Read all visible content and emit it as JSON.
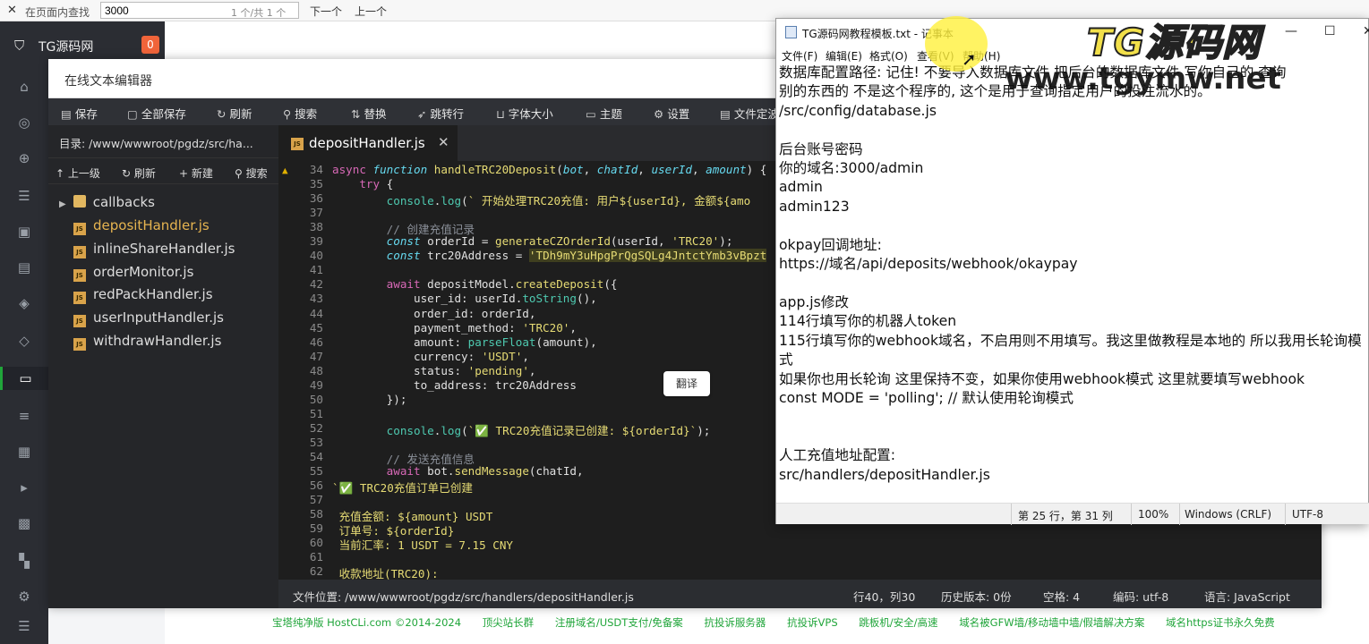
{
  "findbar": {
    "close": "✕",
    "label": "在页面内查找",
    "query": "3000",
    "count": "1 个/共 1 个",
    "next": "下一个",
    "prev": "上一个"
  },
  "brand": {
    "name": "TG源码网",
    "badge": "0"
  },
  "editor": {
    "title": "在线文本编辑器",
    "toolbar": [
      "保存",
      "全部保存",
      "刷新",
      "搜索",
      "替换",
      "跳转行",
      "字体大小",
      "主题",
      "设置",
      "文件定波"
    ],
    "dir": "目录: /www/wwwroot/pgdz/src/ha...",
    "tree_tools": [
      "上一级",
      "刷新",
      "新建",
      "搜索"
    ],
    "files": [
      {
        "name": "callbacks",
        "type": "folder"
      },
      {
        "name": "depositHandler.js",
        "type": "js",
        "selected": true
      },
      {
        "name": "inlineShareHandler.js",
        "type": "js"
      },
      {
        "name": "orderMonitor.js",
        "type": "js"
      },
      {
        "name": "redPackHandler.js",
        "type": "js"
      },
      {
        "name": "userInputHandler.js",
        "type": "js"
      },
      {
        "name": "withdrawHandler.js",
        "type": "js"
      }
    ],
    "tab": "depositHandler.js",
    "translate": "翻译",
    "status": {
      "path": "文件位置: /www/wwwroot/pgdz/src/handlers/depositHandler.js",
      "pos": "行40，列30",
      "history": "历史版本: 0份",
      "indent": "空格: 4",
      "encoding": "编码: utf-8",
      "lang": "语言: JavaScript"
    }
  },
  "code_numbers": [
    "34",
    "35",
    "36",
    "37",
    "38",
    "39",
    "40",
    "41",
    "42",
    "43",
    "44",
    "45",
    "46",
    "47",
    "48",
    "49",
    "50",
    "51",
    "52",
    "53",
    "54",
    "55",
    "56",
    "57",
    "58",
    "59",
    "60",
    "61",
    "62"
  ],
  "notepad": {
    "title": "TG源码网教程模板.txt - 记事本",
    "menu": [
      "文件(F)",
      "编辑(E)",
      "格式(O)",
      "查看(V)",
      "帮助(H)"
    ],
    "lines": [
      "数据库配置路径: 记住! 不要导入数据库文件  把后台的数据库文件 写你自己的  查询",
      "别的东西的 不是这个程序的, 这个是用于查询指定用户的投注流水的。",
      "/src/config/database.js",
      "",
      "后台账号密码",
      "你的域名:3000/admin",
      "admin",
      "admin123",
      "",
      "okpay回调地址:",
      "https://域名/api/deposits/webhook/okaypay",
      "",
      "app.js修改",
      "114行填写你的机器人token",
      "115行填写你的webhook域名，不启用则不用填写。我这里做教程是本地的 所以我用长轮询模",
      "式",
      "如果你也用长轮询 这里保持不变，如果你使用webhook模式 这里就要填写webhook",
      "const MODE = 'polling'; // 默认使用轮询模式",
      "",
      "",
      "人工充值地址配置:",
      "src/handlers/depositHandler.js"
    ],
    "status": {
      "pos": "第 25 行，第 31 列",
      "zoom": "100%",
      "eol": "Windows (CRLF)",
      "enc": "UTF-8"
    }
  },
  "watermark": {
    "brand": "TG源码网",
    "url": "www.tgymw.net"
  },
  "footer": [
    "宝塔纯净版 HostCLi.com ©2014-2024",
    "顶尖站长群",
    "注册域名/USDT支付/免备案",
    "抗投诉服务器",
    "抗投诉VPS",
    "跳板机/安全/高速",
    "域名被GFW墙/移动墙中墙/假墙解决方案",
    "域名https证书永久免费"
  ]
}
